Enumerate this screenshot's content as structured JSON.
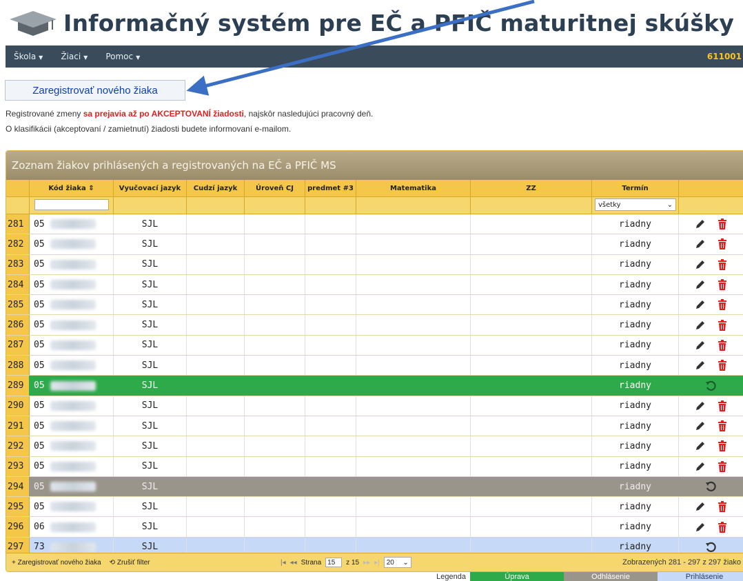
{
  "header": {
    "title": "Informačný systém pre EČ a PFIČ maturitnej skúšky",
    "icon": "graduation-cap-icon"
  },
  "navbar": {
    "items": [
      {
        "label": "Škola"
      },
      {
        "label": "Žiaci"
      },
      {
        "label": "Pomoc"
      }
    ],
    "right_text": "611001"
  },
  "register_button": "Zaregistrovať nového žiaka",
  "info": {
    "line1_a": "Registrované zmeny ",
    "line1_red": "sa prejavia až po AKCEPTOVANÍ žiadosti",
    "line1_b": ", najskôr nasledujúci pracovný deň.",
    "line2": "O klasifikácii (akceptovaní / zamietnutí) žiadosti budete informovaní e-mailom."
  },
  "grid": {
    "caption": "Zoznam žiakov prihlásených a registrovaných na EČ a PFIČ MS",
    "columns": [
      "Kód žiaka",
      "Vyučovací jazyk",
      "Cudzí jazyk",
      "Úroveň CJ",
      "predmet #3",
      "Matematika",
      "ZZ",
      "Termín"
    ],
    "sort_icon": "sort-icon",
    "termin_filter": "všetky",
    "rows": [
      {
        "num": "281",
        "code": "05",
        "lang": "SJL",
        "term": "riadny",
        "state": "normal"
      },
      {
        "num": "282",
        "code": "05",
        "lang": "SJL",
        "term": "riadny",
        "state": "normal"
      },
      {
        "num": "283",
        "code": "05",
        "lang": "SJL",
        "term": "riadny",
        "state": "normal"
      },
      {
        "num": "284",
        "code": "05",
        "lang": "SJL",
        "term": "riadny",
        "state": "normal"
      },
      {
        "num": "285",
        "code": "05",
        "lang": "SJL",
        "term": "riadny",
        "state": "normal"
      },
      {
        "num": "286",
        "code": "05",
        "lang": "SJL",
        "term": "riadny",
        "state": "normal"
      },
      {
        "num": "287",
        "code": "05",
        "lang": "SJL",
        "term": "riadny",
        "state": "normal"
      },
      {
        "num": "288",
        "code": "05",
        "lang": "SJL",
        "term": "riadny",
        "state": "normal"
      },
      {
        "num": "289",
        "code": "05",
        "lang": "SJL",
        "term": "riadny",
        "state": "green"
      },
      {
        "num": "290",
        "code": "05",
        "lang": "SJL",
        "term": "riadny",
        "state": "normal"
      },
      {
        "num": "291",
        "code": "05",
        "lang": "SJL",
        "term": "riadny",
        "state": "normal"
      },
      {
        "num": "292",
        "code": "05",
        "lang": "SJL",
        "term": "riadny",
        "state": "normal"
      },
      {
        "num": "293",
        "code": "05",
        "lang": "SJL",
        "term": "riadny",
        "state": "normal"
      },
      {
        "num": "294",
        "code": "05",
        "lang": "SJL",
        "term": "riadny",
        "state": "grey"
      },
      {
        "num": "295",
        "code": "05",
        "lang": "SJL",
        "term": "riadny",
        "state": "normal"
      },
      {
        "num": "296",
        "code": "06",
        "lang": "SJL",
        "term": "riadny",
        "state": "normal"
      },
      {
        "num": "297",
        "code": "73",
        "lang": "SJL",
        "term": "riadny",
        "state": "blue"
      }
    ],
    "colors": {
      "green": "#2eaa4b",
      "grey": "#9a958b",
      "blue": "#c6d9f6",
      "header": "#f4c64a"
    }
  },
  "pager": {
    "add_label": "Zaregistrovať nového žiaka",
    "reset_label": "Zrušiť filter",
    "page_label": "Strana",
    "page_value": "15",
    "of_label": "z 15",
    "page_size": "20",
    "summary": "Zobrazených 281 - 297 z 297 žiako"
  },
  "legend": {
    "label": "Legenda",
    "edit": "Úprava",
    "signoff": "Odhlásenie",
    "signon": "Prihlásenie"
  }
}
